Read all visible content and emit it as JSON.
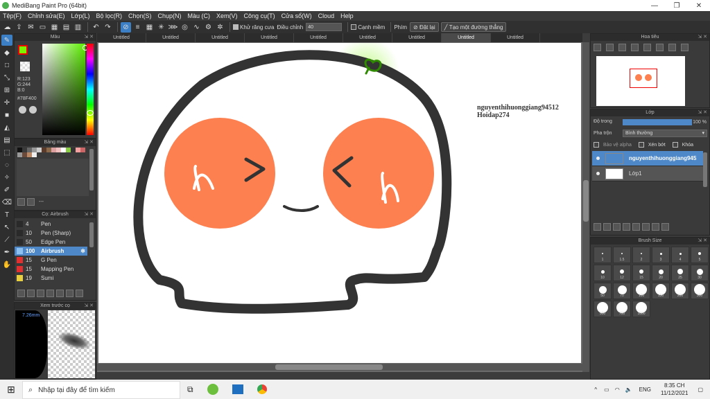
{
  "window": {
    "title": "MediBang Paint Pro (64bit)",
    "controls": [
      "—",
      "❐",
      "✕"
    ]
  },
  "menu": [
    "Tệp(F)",
    "Chỉnh sửa(E)",
    "Lớp(L)",
    "Bộ lọc(R)",
    "Chọn(S)",
    "Chụp(N)",
    "Màu (C)",
    "Xem(V)",
    "Công cụ(T)",
    "Cửa sổ(W)",
    "Cloud",
    "Help"
  ],
  "toolbar": {
    "antialias_label": "Khử răng cưa",
    "adjust_label": "Điều chỉnh",
    "adjust_value": "40",
    "soft_edge_label": "Cạnh mềm",
    "key_label": "Phím",
    "reset_label": "Đặt lại",
    "straight_line_label": "Tạo một đường thẳng"
  },
  "tabs": [
    "Untitled",
    "Untitled",
    "Untitled",
    "Untitled",
    "Untitled",
    "Untitled",
    "Untitled",
    "Untitled",
    "Untitled"
  ],
  "color_panel": {
    "title": "Màu",
    "r": "R:123",
    "g": "G:244",
    "b": "B:0",
    "hex": "#78F400",
    "fg_color": "#7bf400"
  },
  "palette_panel": {
    "title": "Bảng màu",
    "input_value": "---",
    "swatches": [
      "#111111",
      "#3a3a3a",
      "#666666",
      "#999999",
      "#cccccc",
      "#5a3a2a",
      "#8a6a4a",
      "#dda0a0",
      "#f0c0c0",
      "#ffffff",
      "#88cc44",
      "#333333",
      "#f4a0a0",
      "#cc6666",
      "#999999",
      "#6a4a3a",
      "#bb8866",
      "#eeeeee"
    ]
  },
  "brush_panel": {
    "title": "Cọ: Airbrush",
    "items": [
      {
        "size": "4",
        "name": "Pen",
        "color": "#2a2a2a"
      },
      {
        "size": "10",
        "name": "Pen (Sharp)",
        "color": "#2a2a2a"
      },
      {
        "size": "50",
        "name": "Edge Pen",
        "color": "#2a2a2a"
      },
      {
        "size": "100",
        "name": "Airbrush",
        "color": "#8ec0f0"
      },
      {
        "size": "15",
        "name": "G Pen",
        "color": "#e03030"
      },
      {
        "size": "15",
        "name": "Mapping Pen",
        "color": "#e03030"
      },
      {
        "size": "19",
        "name": "Sumi",
        "color": "#e8d040"
      }
    ]
  },
  "preview_panel": {
    "title": "Xem trước cọ",
    "size_text": "7.26mm"
  },
  "navigator_panel": {
    "title": "Hoa tiêu"
  },
  "layer_panel": {
    "title": "Lớp",
    "opacity_label": "Độ trong",
    "opacity_value": "100 %",
    "opacity_fraction": 1.0,
    "blend_label": "Pha trộn",
    "blend_value": "Bình thường",
    "protect_alpha_label": "Bảo vệ alpha",
    "clip_label": "Xén bớt",
    "lock_label": "Khóa",
    "layers": [
      {
        "name": "nguyenthihuonggiang94512 Hoidap274",
        "selected": true
      },
      {
        "name": "Lớp1",
        "selected": false
      }
    ]
  },
  "brush_size_panel": {
    "title": "Brush Size",
    "sizes": [
      "1",
      "1.5",
      "2",
      "3",
      "4",
      "5",
      "10",
      "12",
      "15",
      "20",
      "25",
      "30",
      "50",
      "70",
      "100",
      "150",
      "200",
      "300",
      "500",
      "700",
      "1000"
    ]
  },
  "canvas": {
    "watermark_line1": "nguyenthihuonggiang94512",
    "watermark_line2": "Hoidap274",
    "outline_color": "#333333",
    "cheek_color": "#fd8050",
    "sprout_color": "#7bf400"
  },
  "taskbar": {
    "search_placeholder": "Nhập tại đây để tìm kiếm",
    "lang": "ENG",
    "time": "8:35 CH",
    "date": "11/12/2021"
  }
}
